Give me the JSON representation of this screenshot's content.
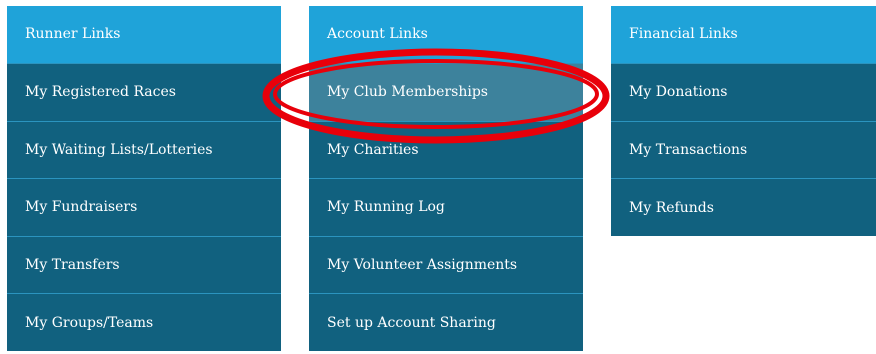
{
  "columns": [
    {
      "header": "Runner Links",
      "items": [
        "My Registered Races",
        "My Waiting Lists/Lotteries",
        "My Fundraisers",
        "My Transfers",
        "My Groups/Teams"
      ]
    },
    {
      "header": "Account Links",
      "items": [
        "My Club Memberships",
        "My Charities",
        "My Running Log",
        "My Volunteer Assignments",
        "Set up Account Sharing"
      ]
    },
    {
      "header": "Financial Links",
      "items": [
        "My Donations",
        "My Transactions",
        "My Refunds"
      ]
    }
  ],
  "colors": {
    "header_bg": "#1fa3d9",
    "item_bg": "#11617f",
    "active_item_bg": "#3d829c",
    "annotation": "#e8000a"
  },
  "annotation": {
    "target": "My Club Memberships",
    "shape": "red-ellipse"
  }
}
